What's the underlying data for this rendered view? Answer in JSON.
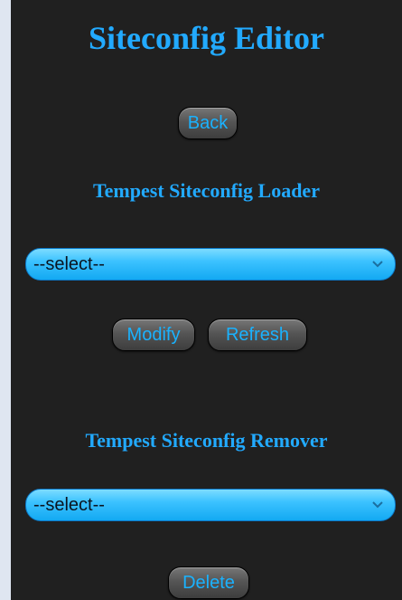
{
  "page": {
    "title": "Siteconfig Editor",
    "back_label": "Back"
  },
  "loader": {
    "heading": "Tempest Siteconfig Loader",
    "select_value": "--select--",
    "modify_label": "Modify",
    "refresh_label": "Refresh"
  },
  "remover": {
    "heading": "Tempest Siteconfig Remover",
    "select_value": "--select--",
    "delete_label": "Delete"
  },
  "colors": {
    "background": "#202020",
    "accent_text": "#22aaff",
    "button_text": "#1ab2ff",
    "select_fill": "#3cc2ff"
  },
  "icons": {
    "dropdown": "chevron-down-icon"
  }
}
